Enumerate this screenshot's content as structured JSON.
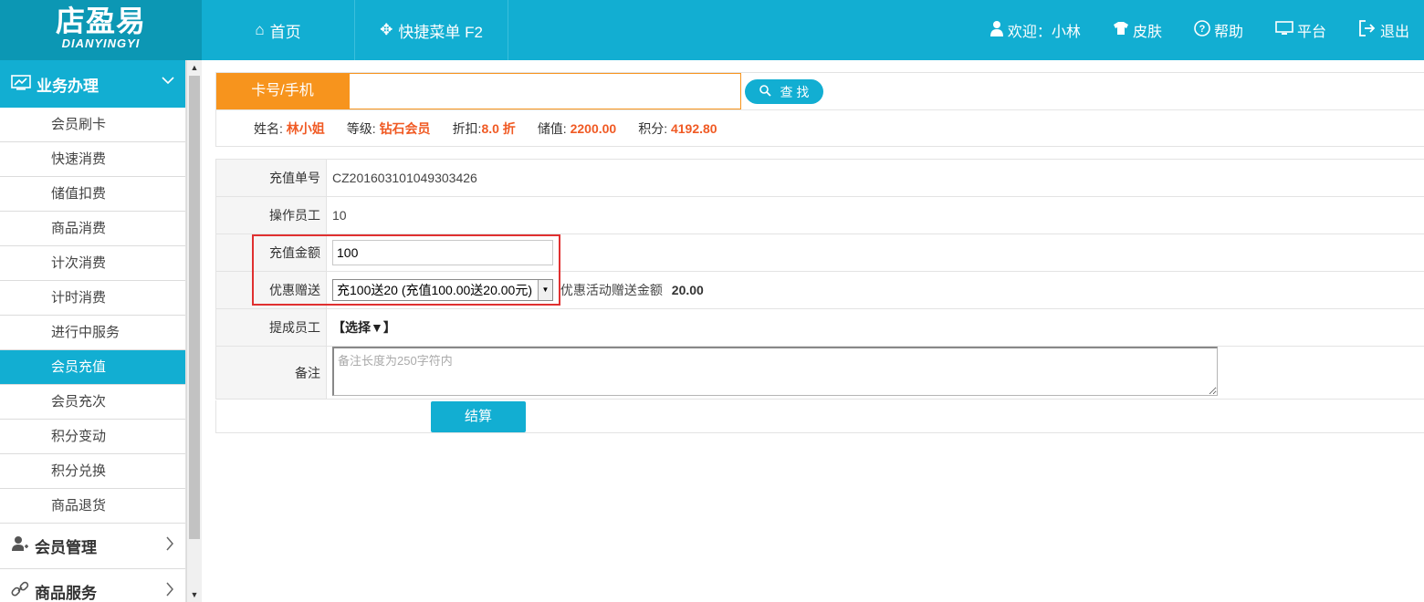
{
  "header": {
    "logo_cn": "店盈易",
    "logo_en": "DIANYINGYI",
    "nav": {
      "home": "首页",
      "quick_menu": "快捷菜单 F2"
    },
    "right": {
      "welcome": "欢迎：小林",
      "skin": "皮肤",
      "help": "帮助",
      "platform": "平台",
      "logout": "退出"
    }
  },
  "sidebar": {
    "active_group": "业务办理",
    "items": [
      {
        "label": "会员刷卡"
      },
      {
        "label": "快速消费"
      },
      {
        "label": "储值扣费"
      },
      {
        "label": "商品消费"
      },
      {
        "label": "计次消费"
      },
      {
        "label": "计时消费"
      },
      {
        "label": "进行中服务"
      },
      {
        "label": "会员充值"
      },
      {
        "label": "会员充次"
      },
      {
        "label": "积分变动"
      },
      {
        "label": "积分兑换"
      },
      {
        "label": "商品退货"
      }
    ],
    "groups": [
      {
        "label": "会员管理"
      },
      {
        "label": "商品服务"
      }
    ]
  },
  "search": {
    "label": "卡号/手机",
    "value": "",
    "button": "查 找"
  },
  "member": {
    "name_label": "姓名:",
    "name": "林小姐",
    "level_label": "等级:",
    "level": "钻石会员",
    "discount_label": "折扣:",
    "discount": "8.0 折",
    "balance_label": "储值:",
    "balance": "2200.00",
    "points_label": "积分:",
    "points": "4192.80"
  },
  "form": {
    "order_no_label": "充值单号",
    "order_no": "CZ201603101049303426",
    "staff_label": "操作员工",
    "staff": "10",
    "amount_label": "充值金额",
    "amount": "100",
    "promo_label": "优惠赠送",
    "promo_selected": "充100送20 (充值100.00送20.00元)",
    "promo_gift_label": "优惠活动赠送金额",
    "promo_gift_value": "20.00",
    "commission_label": "提成员工",
    "commission_choose": "【选择▼】",
    "remark_label": "备注",
    "remark_placeholder": "备注长度为250字符内",
    "submit": "结算"
  },
  "colors": {
    "primary": "#12aed2",
    "logo_bg": "#0c97b4",
    "search_label": "#f7941d",
    "value_highlight": "#f05a24",
    "annotation_box": "#e03030"
  }
}
